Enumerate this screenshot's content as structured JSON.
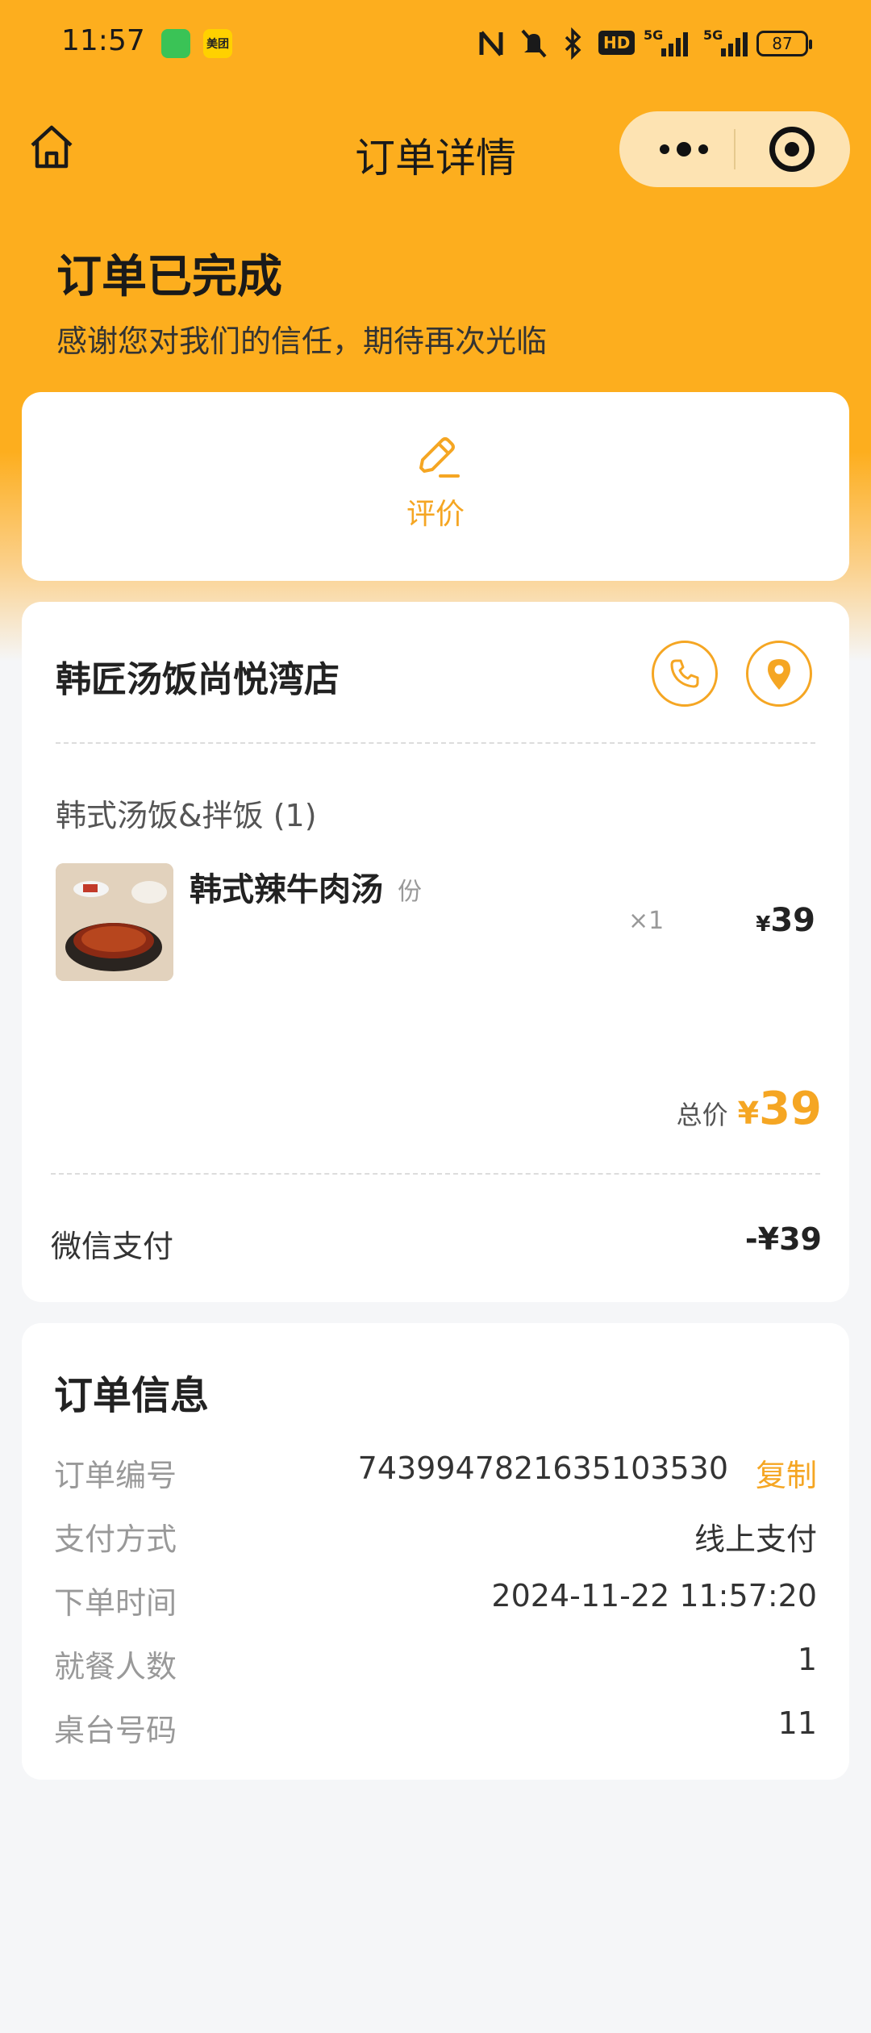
{
  "status_bar": {
    "time": "11:57",
    "meituan_label": "美团",
    "hd_label": "HD",
    "sig1_label": "5G",
    "sig2_label": "5G",
    "battery": "87"
  },
  "nav": {
    "title": "订单详情"
  },
  "header": {
    "status": "订单已完成",
    "subtitle": "感谢您对我们的信任，期待再次光临"
  },
  "review": {
    "label": "评价"
  },
  "store": {
    "name": "韩匠汤饭尚悦湾店",
    "category": "韩式汤饭&拌饭 (1)",
    "item": {
      "name": "韩式辣牛肉汤",
      "unit": "份",
      "qty": "×1",
      "currency": "¥",
      "price": "39"
    },
    "total_label": "总价",
    "total_currency": "¥",
    "total_value": "39",
    "pay_method": "微信支付",
    "pay_amount": "-¥39"
  },
  "order_info": {
    "title": "订单信息",
    "rows": [
      {
        "label": "订单编号",
        "value": "7439947821635103530"
      },
      {
        "label": "支付方式",
        "value": "线上支付"
      },
      {
        "label": "下单时间",
        "value": "2024-11-22 11:57:20"
      },
      {
        "label": "就餐人数",
        "value": "1"
      },
      {
        "label": "桌台号码",
        "value": "11"
      }
    ],
    "copy_label": "复制"
  },
  "colors": {
    "brand": "#fdae1e",
    "accent": "#f5a623",
    "background": "#f5f6f8"
  }
}
